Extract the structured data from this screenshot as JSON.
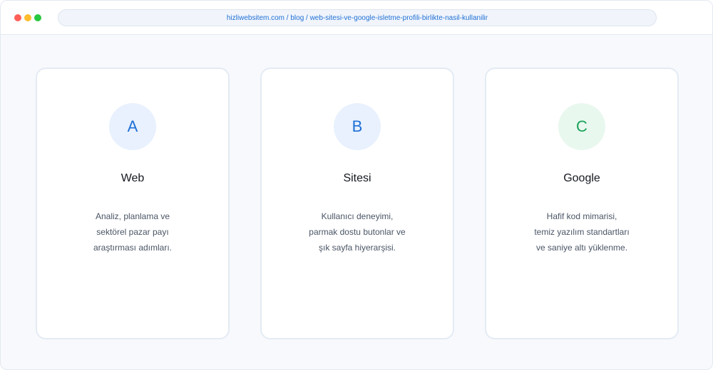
{
  "browser": {
    "url": "hizliwebsitem.com / blog / web-sitesi-ve-google-isletme-profili-birlikte-nasil-kullanilir"
  },
  "cards": [
    {
      "badge": "A",
      "title": "Web",
      "lines": [
        "Analiz, planlama ve",
        "sektörel pazar payı",
        "araştırması adımları."
      ]
    },
    {
      "badge": "B",
      "title": "Sitesi",
      "lines": [
        "Kullanıcı deneyimi,",
        "parmak dostu butonlar ve",
        "şık sayfa hiyerarşisi."
      ]
    },
    {
      "badge": "C",
      "title": "Google",
      "lines": [
        "Hafif kod mimarisi,",
        "temiz yazılım standartları",
        "ve saniye altı yüklenme."
      ]
    }
  ],
  "colors": {
    "accent_blue": "#1f6fd6",
    "accent_green": "#1aa35a"
  }
}
